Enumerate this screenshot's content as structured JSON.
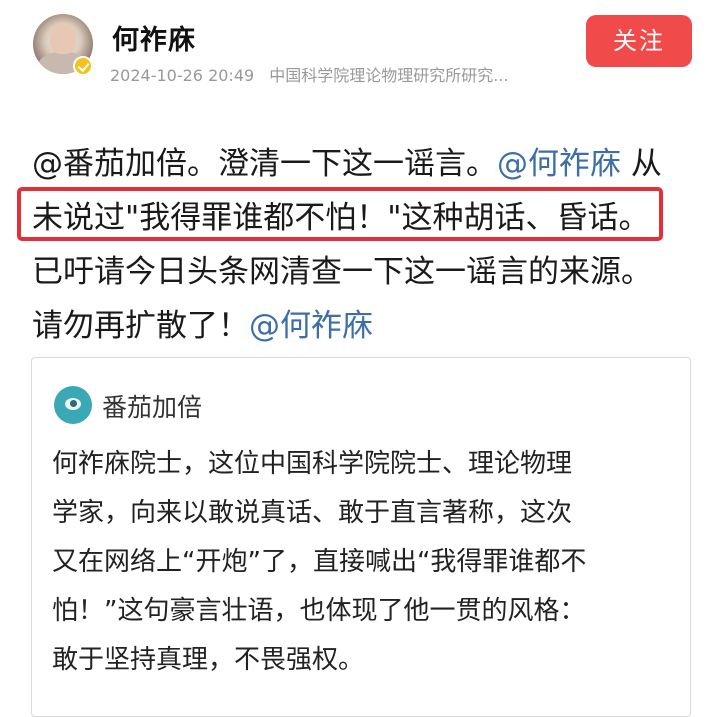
{
  "post": {
    "author": "何祚庥",
    "timestamp": "2024-10-26 20:49",
    "affiliation": "中国科学院理论物理研究所研究...",
    "follow_label": "关注",
    "text_lines": [
      {
        "before": "@番茄加倍。澄清一下这一谣言。",
        "mention": "@何祚庥",
        "after": " 从"
      },
      {
        "before": "未说过\"我得罪谁都不怕！\"这种胡话、昏话。",
        "mention": "",
        "after": ""
      },
      {
        "before": "已吁请今日头条网清查一下这一谣言的来源。",
        "mention": "",
        "after": ""
      },
      {
        "before": "请勿再扩散了！",
        "mention": "@何祚庥",
        "after": ""
      }
    ]
  },
  "quote": {
    "author": "番茄加倍",
    "lines": [
      "何祚庥院士，这位中国科学院院士、理论物理",
      "学家，向来以敢说真话、敢于直言著称，这次",
      "又在网络上“开炮”了，直接喊出“我得罪谁都不",
      "怕！”这句豪言壮语，也体现了他一贯的风格：",
      "敢于坚持真理，不畏强权。"
    ]
  },
  "colors": {
    "follow_button": "#f04a4a",
    "mention": "#3d6ea5",
    "highlight_border": "#e0313b",
    "verified_badge": "#f5c21b"
  },
  "icons": {
    "verified": "verified-badge-icon",
    "author_avatar": "avatar",
    "quote_avatar": "quote-author-avatar"
  }
}
